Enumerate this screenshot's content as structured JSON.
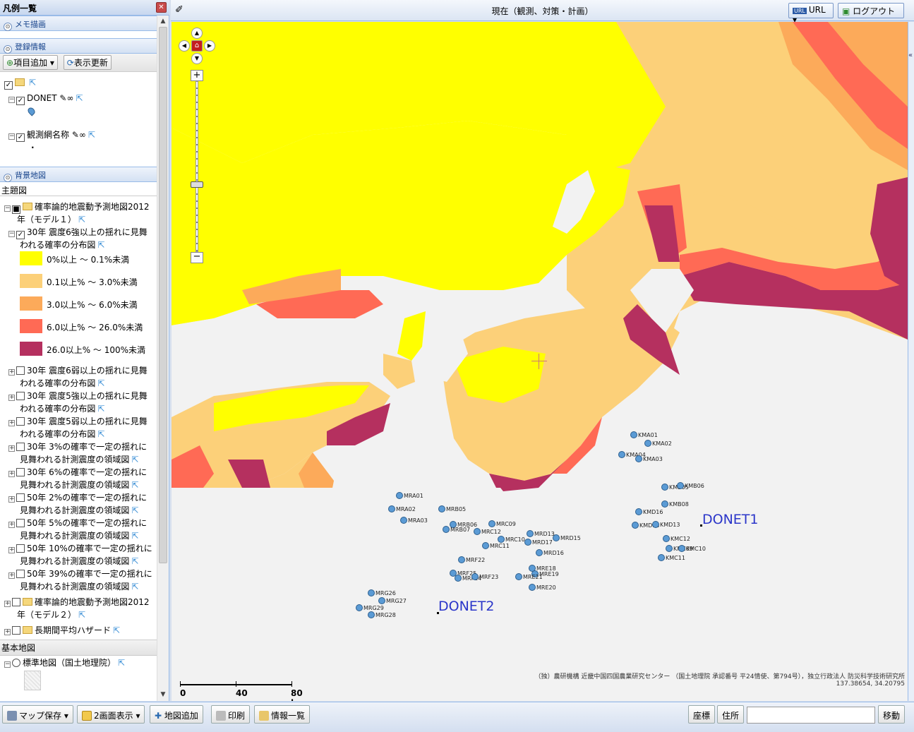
{
  "legend_panel": {
    "title": "凡例一覧",
    "close_icon": "close-icon",
    "memo_section": "メモ描画",
    "registered_section": "登録情報",
    "add_item_label": "項目追加",
    "refresh_label": "表示更新",
    "layers": [
      {
        "label": "DONET"
      },
      {
        "label": "観測網名称"
      }
    ],
    "background_section": "背景地図",
    "thematic_label": "主題図",
    "thematic_items": [
      {
        "label": "確率論的地震動予測地図2012",
        "label2": "年（モデル１）"
      },
      {
        "label": "30年 震度6強以上の揺れに見舞",
        "label2": "われる確率の分布図"
      }
    ],
    "legend_entries": [
      {
        "label": "0%以上 ～ 0.1%未満",
        "color": "#ffff00"
      },
      {
        "label": "0.1以上% ～ 3.0%未満",
        "color": "#fcd079"
      },
      {
        "label": "3.0以上% ～ 6.0%未満",
        "color": "#fcaa5a"
      },
      {
        "label": "6.0以上% ～ 26.0%未満",
        "color": "#ff6a55"
      },
      {
        "label": "26.0以上% ～ 100%未満",
        "color": "#b5305f"
      }
    ],
    "other_layers": [
      {
        "label": "30年 震度6弱以上の揺れに見舞",
        "label2": "われる確率の分布図"
      },
      {
        "label": "30年 震度5強以上の揺れに見舞",
        "label2": "われる確率の分布図"
      },
      {
        "label": "30年 震度5弱以上の揺れに見舞",
        "label2": "われる確率の分布図"
      },
      {
        "label": "30年 3%の確率で一定の揺れに",
        "label2": "見舞われる計測震度の領域図"
      },
      {
        "label": "30年 6%の確率で一定の揺れに",
        "label2": "見舞われる計測震度の領域図"
      },
      {
        "label": "50年 2%の確率で一定の揺れに",
        "label2": "見舞われる計測震度の領域図"
      },
      {
        "label": "50年 5%の確率で一定の揺れに",
        "label2": "見舞われる計測震度の領域図"
      },
      {
        "label": "50年 10%の確率で一定の揺れに",
        "label2": "見舞われる計測震度の領域図"
      },
      {
        "label": "50年 39%の確率で一定の揺れに",
        "label2": "見舞われる計測震度の領域図"
      }
    ],
    "model2": {
      "label": "確率論的地震動予測地図2012",
      "label2": "年（モデル２）"
    },
    "long_term": "長期間平均ハザード",
    "base_map_section": "基本地図",
    "base_map_item": "標準地図（国土地理院）"
  },
  "header": {
    "title": "現在（観測、対策・計画）",
    "url_label": "URL",
    "logout_label": "ログアウト"
  },
  "map": {
    "attribution": "（独）農研機構 近畿中国四国農業研究センター （国土地理院 承認番号 平24情使、第794号），独立行政法人 防災科学技術研究所",
    "coords": "137.38654, 34.20795",
    "scale": {
      "ticks": [
        "0",
        "40",
        "80 km"
      ]
    },
    "network_labels": [
      "DONET1",
      "DONET2"
    ],
    "stations": [
      "KMA01",
      "KMA02",
      "KMA04",
      "KMA03",
      "KMB05",
      "KMB06",
      "KMB08",
      "KMD16",
      "KMD14",
      "KMD13",
      "KMC12",
      "KMC09",
      "KMC10",
      "KMC11",
      "MRA01",
      "MRA02",
      "MRA03",
      "MRB05",
      "MRB06",
      "MRB07",
      "MRC09",
      "MRC12",
      "MRC10",
      "MRC11",
      "MRD13",
      "MRD15",
      "MRD17",
      "MRD16",
      "MRF22",
      "MRF25",
      "MRF24",
      "MRF23",
      "MRE18",
      "MRE19",
      "MRE21",
      "MRE20",
      "MRG26",
      "MRG27",
      "MRG29",
      "MRG28"
    ]
  },
  "bottom_toolbar": {
    "save_map": "マップ保存",
    "dual_view": "2画面表示",
    "add_map": "地図追加",
    "print": "印刷",
    "info_list": "情報一覧",
    "coord_btn": "座標",
    "address_btn": "住所",
    "search_value": "",
    "move_btn": "移動"
  }
}
